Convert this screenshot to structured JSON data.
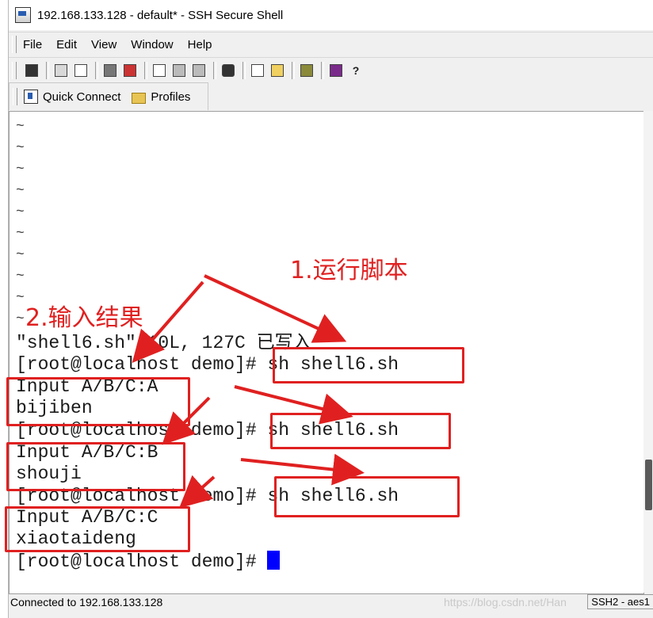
{
  "window": {
    "title": "192.168.133.128 - default* - SSH Secure Shell"
  },
  "menu": {
    "items": [
      {
        "label": "File"
      },
      {
        "label": "Edit"
      },
      {
        "label": "View"
      },
      {
        "label": "Window"
      },
      {
        "label": "Help"
      }
    ]
  },
  "toolbar": {
    "icons": [
      "save-icon",
      "print-icon",
      "print-preview-icon",
      "disconnect-icon",
      "connect-icon",
      "copy-icon",
      "paste-icon",
      "paste-alt-icon",
      "find-icon",
      "new-terminal-icon",
      "new-file-transfer-icon",
      "settings-icon",
      "help-book-icon",
      "whats-this-icon"
    ]
  },
  "profilebar": {
    "quick_connect": "Quick Connect",
    "profiles": "Profiles"
  },
  "terminal": {
    "tilde": "~",
    "lines": {
      "write_msg": "\"shell6.sh\" 10L, 127C 已写入",
      "prompt1": "[root@localhost demo]# sh shell6.sh",
      "input_a": "Input A/B/C:A",
      "result_a": "bijiben",
      "prompt2": "[root@localhost demo]# sh shell6.sh",
      "input_b": "Input A/B/C:B",
      "result_b": "shouji",
      "prompt3": "[root@localhost demo]# sh shell6.sh",
      "input_c": "Input A/B/C:C",
      "result_c": "xiaotaideng",
      "prompt4": "[root@localhost demo]# "
    }
  },
  "status": {
    "connection": "Connected to 192.168.133.128",
    "protocol": "SSH2 - aes1"
  },
  "annotations": {
    "run_script": "1.运行脚本",
    "input_result": "2.输入结果"
  },
  "watermark": "https://blog.csdn.net/Han",
  "colors": {
    "annotation": "#e02020",
    "cursor": "#0000ff"
  }
}
